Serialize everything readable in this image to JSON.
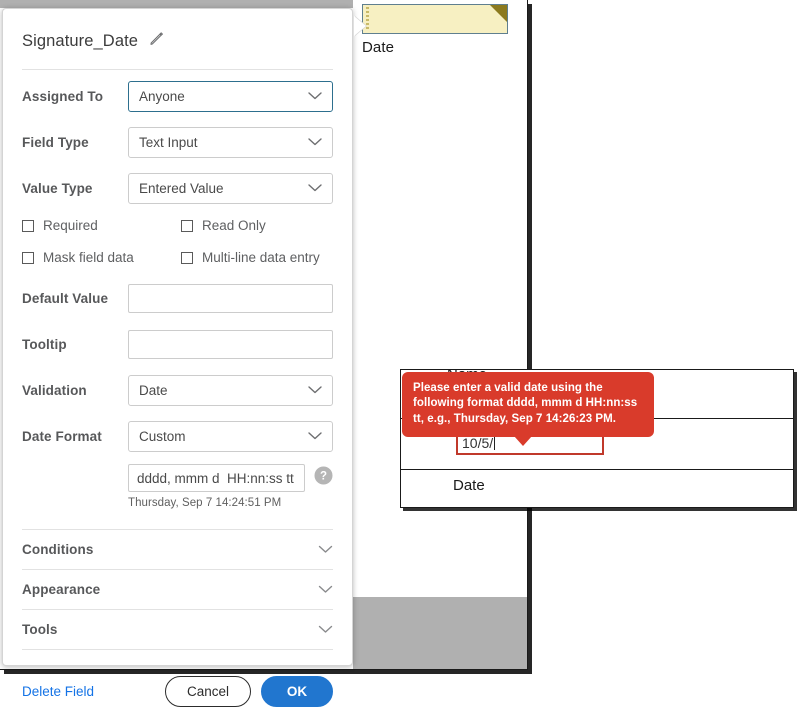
{
  "document": {
    "yellow_field": {
      "label": "Date",
      "icon": "form-field-corner-marker",
      "fill_color": "#f7f0c2"
    }
  },
  "preview_panel": {
    "name_label": "Name",
    "date_input_value": "10/5/",
    "date_label": "Date",
    "invalid_border_color": "#c0392b"
  },
  "error_tooltip": {
    "message": "Please enter a valid date using the following format dddd, mmm d HH:nn:ss tt, e.g., Thursday, Sep 7 14:26:23 PM.",
    "background_color": "#d93b2b"
  },
  "dialog": {
    "title": "Signature_Date",
    "edit_icon": "pencil-icon",
    "rows": {
      "assigned_to": {
        "label": "Assigned To",
        "value": "Anyone"
      },
      "field_type": {
        "label": "Field Type",
        "value": "Text Input"
      },
      "value_type": {
        "label": "Value Type",
        "value": "Entered Value"
      },
      "default_value": {
        "label": "Default Value",
        "value": ""
      },
      "tooltip": {
        "label": "Tooltip",
        "value": ""
      },
      "validation": {
        "label": "Validation",
        "value": "Date"
      },
      "date_format": {
        "label": "Date Format",
        "value": "Custom"
      }
    },
    "checkboxes": [
      {
        "label": "Required",
        "checked": false
      },
      {
        "label": "Read Only",
        "checked": false
      },
      {
        "label": "Mask field data",
        "checked": false
      },
      {
        "label": "Multi-line data entry",
        "checked": false
      }
    ],
    "custom_format": {
      "value": "dddd, mmm d  HH:nn:ss tt",
      "preview": "Thursday, Sep 7 14:24:51 PM",
      "help_icon": "question-mark-icon"
    },
    "accordions": [
      {
        "label": "Conditions"
      },
      {
        "label": "Appearance"
      },
      {
        "label": "Tools"
      }
    ],
    "footer": {
      "delete_label": "Delete Field",
      "cancel_label": "Cancel",
      "ok_label": "OK",
      "ok_color": "#2176cf",
      "link_color": "#1473e6"
    }
  }
}
